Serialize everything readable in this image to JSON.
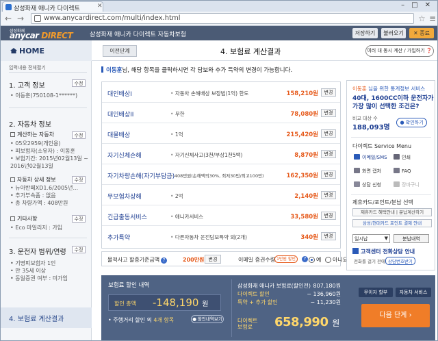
{
  "browser": {
    "tab_title": "삼성화재 애니카 다이렉트",
    "url": "www.anycardirect.com/multi/index.html"
  },
  "header": {
    "logo_small": "삼성화재",
    "logo_main": "anycar",
    "logo_accent": "DIRECT",
    "title": "삼성화재 애니카 다이렉트 자동차보험",
    "btn_save": "저장하기",
    "btn_load": "불러오기",
    "btn_close": "✕ 종료"
  },
  "sidebar": {
    "home": "HOME",
    "subtitle": "입력내용 전체펼기",
    "s1": {
      "title": "1. 고객 정보",
      "edit": "수정",
      "line1": "• 이동훈(750108-1******)"
    },
    "s2": {
      "title": "2. 자동차 정보",
      "edit": "수정",
      "g1_title": "계산하는 자동차",
      "g1_edit": "수정",
      "g1_lines": [
        "• 05오2959(개인용)",
        "• 피보험자(소유자) : 이동훈",
        "• 보험기간: 2015년02월13일 ~",
        "  2016년02월13일"
      ],
      "g2_title": "자동차 상세 정보",
      "g2_edit": "수정",
      "g2_lines": [
        "• 뉴아반떼XD1.6/2005년...",
        "• 추가부속품 : 없음",
        "• 총 차량가액 : 408만원"
      ],
      "g3_title": "기타사항",
      "g3_edit": "수정",
      "g3_lines": [
        "• Eco 마일리지 : 가입"
      ]
    },
    "s3": {
      "title": "3. 운전자 범위/연령",
      "edit": "수정",
      "lines": [
        "• 기명피보험자 1인",
        "• 만 35세 이상",
        "• 동일증권 여부 : 미가입"
      ]
    },
    "s4": {
      "title": "4. 보험료 계산결과"
    }
  },
  "main": {
    "prev": "이전단계",
    "step_title": "4. 보험료 계산결과",
    "multi": "여러 대 동시 계산 / 가입하기 ❓",
    "notice_name": "이동훈",
    "notice_text": "님, 해당 항목을 클릭하시면 각 담보와 추가 특약의 변경이 가능합니다.",
    "coverages": [
      {
        "name": "대인배상I",
        "desc": "자동차 손해배상 보장법(1억) 한도",
        "amount": "158,210원",
        "btn": "변경"
      },
      {
        "name": "대인배상II",
        "desc": "무한",
        "amount": "78,080원",
        "btn": "변경"
      },
      {
        "name": "대물배상",
        "desc": "1억",
        "amount": "215,420원",
        "btn": "변경"
      },
      {
        "name": "자기신체손해",
        "desc": "자기신체사고(3천/부상1천5백)",
        "amount": "8,870원",
        "btn": "변경"
      },
      {
        "name": "자기차량손해(자기부담금)",
        "desc": "408만원(손해액의30%, 최저30만/최고100만)",
        "amount": "162,350원",
        "btn": "변경"
      },
      {
        "name": "무보험차상해",
        "desc": "2억",
        "amount": "2,140원",
        "btn": "변경"
      },
      {
        "name": "긴급출동서비스",
        "desc": "애니카서비스",
        "amount": "33,580원",
        "btn": "변경"
      },
      {
        "name": "추가특약",
        "desc": "다른자동차 운전담보특약 외(2개)",
        "amount": "340원",
        "btn": "변경"
      }
    ],
    "deduct_label": "물적사고 할증기준금액",
    "deduct_value": "200만원",
    "deduct_btn": "변경",
    "email_label": "이메일 증권수령",
    "email_badge": "1만원 할인",
    "radio_yes": "예",
    "radio_no": "아니요"
  },
  "right": {
    "line1_name": "이동훈",
    "line1_rest": " 님을 위한 통계정보 서비스",
    "line2a": "40대, 1600CC이하 운전자가",
    "line2b": "가장 많이 선택한 조건은?",
    "avg_label": "비교 대상 수",
    "avg_value": "188,093명",
    "confirm": "● 확인하기",
    "svc_title": "다이렉트 Service Menu",
    "svc": [
      "이메일/SMS",
      "인쇄",
      "화면 캡처",
      "FAQ",
      "상담 신청",
      "장바구니"
    ],
    "card_title": "제휴카드/포인트/분납 선택",
    "card_btns": [
      "제휴카드 혜택안내 | 분납계산하기",
      "삼성/현대카드 포인트 결제 안내"
    ],
    "select_val": "일시납",
    "select_btn": "분납내역",
    "consult_title": "고객센터 전화상담 안내",
    "consult_pre": "전화를 걸기 전에 ",
    "consult_badge": "상담번호받기"
  },
  "bottom": {
    "title": "보험료 할인 내역",
    "disc_label": "할인 총액",
    "disc_value": "-148,190",
    "won": "원",
    "note_pre": "• 주행거리 할인 외 ",
    "note_hl": "4개 항목",
    "note_btn": "● 할인내역보기",
    "lines": [
      {
        "label": "삼성화재 애니카 보험료(할인전)",
        "value": "807,180원"
      },
      {
        "label": "다이렉트 할인",
        "value": "− 136,960원"
      },
      {
        "label": "특약 + 추가 할인",
        "value": "− 11,230원"
      }
    ],
    "total_label1": "다이렉트",
    "total_label2": "보험료",
    "total_value": "658,990",
    "btn_no": "무이자 할부",
    "btn_car": "자동차 서비스",
    "next": "다음 단계 ›"
  }
}
